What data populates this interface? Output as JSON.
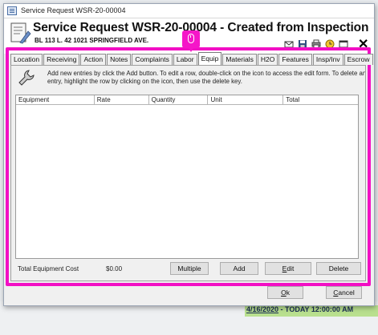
{
  "window": {
    "title": "Service Request WSR-20-00004",
    "heading": "Service Request WSR-20-00004 - Created from Inspection",
    "subheading": "BL 113 L. 42  1021 SPRINGFIELD AVE."
  },
  "header_tools": [
    "mail-icon",
    "save-icon",
    "print-icon",
    "clock-icon",
    "window-icon"
  ],
  "tabs": [
    {
      "label": "Location",
      "active": false
    },
    {
      "label": "Receiving",
      "active": false
    },
    {
      "label": "Action",
      "active": false
    },
    {
      "label": "Notes",
      "active": false
    },
    {
      "label": "Complaints",
      "active": false
    },
    {
      "label": "Labor",
      "active": false
    },
    {
      "label": "Equip",
      "active": true
    },
    {
      "label": "Materials",
      "active": false
    },
    {
      "label": "H2O",
      "active": false
    },
    {
      "label": "Features",
      "active": false
    },
    {
      "label": "Insp/Inv",
      "active": false
    },
    {
      "label": "Escrow",
      "active": false
    }
  ],
  "help_text": {
    "line1": "Add new entries by click the Add button.  To edit a row, double-click on the icon to access the edit form.  To delete an",
    "line2": "entry, highlight the row by clicking on the icon, then use the delete key."
  },
  "grid": {
    "columns": [
      "Equipment",
      "Rate",
      "Quantity",
      "Unit",
      "Total"
    ]
  },
  "footer": {
    "total_label": "Total Equipment Cost",
    "total_value": "$0.00"
  },
  "buttons": {
    "multiple": "Multiple",
    "add": "Add",
    "edit_prefix": "E",
    "edit_rest": "dit",
    "delete": "Delete",
    "ok_prefix": "O",
    "ok_rest": "k",
    "cancel_prefix": "C",
    "cancel_rest": "ancel"
  },
  "background": {
    "date_text": "4/16/2020",
    "date_suffix": " - TODAY 12:00:00 AM"
  },
  "colors": {
    "highlight": "#f20fc4",
    "cursor_badge": "#f516c8",
    "bg_row": "#b9e08f"
  }
}
